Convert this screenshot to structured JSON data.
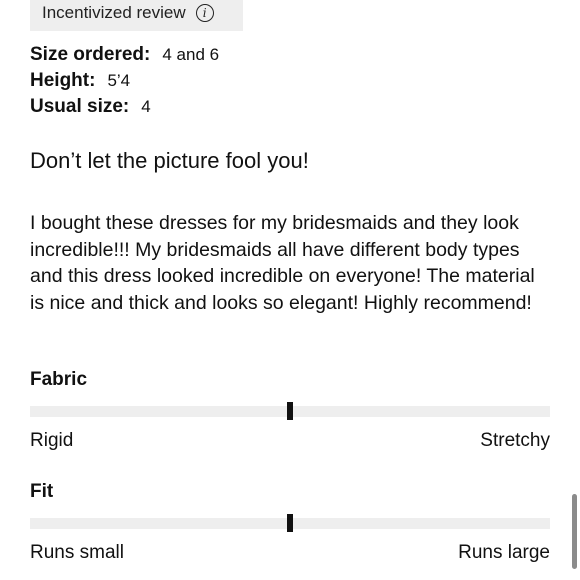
{
  "badge": {
    "label": "Incentivized review",
    "icon": "info-icon"
  },
  "meta": [
    {
      "key": "Size ordered:",
      "value": "4 and 6"
    },
    {
      "key": "Height:",
      "value": "5’4"
    },
    {
      "key": "Usual size:",
      "value": "4"
    }
  ],
  "review": {
    "title": "Don’t let the picture fool you!",
    "body": "I bought these dresses for my bridesmaids and they look incredible!!! My bridesmaids all have different body types and this dress looked incredible on everyone! The material is nice and thick and looks so elegant! Highly recommend!"
  },
  "fabric": {
    "label": "Fabric",
    "min_label": "Rigid",
    "max_label": "Stretchy",
    "position": 0.5
  },
  "fit": {
    "label": "Fit",
    "min_label": "Runs small",
    "max_label": "Runs large",
    "position": 0.5
  },
  "colors": {
    "track": "#eeeeee",
    "marker": "#111111",
    "badge_bg": "#eeeeee"
  }
}
